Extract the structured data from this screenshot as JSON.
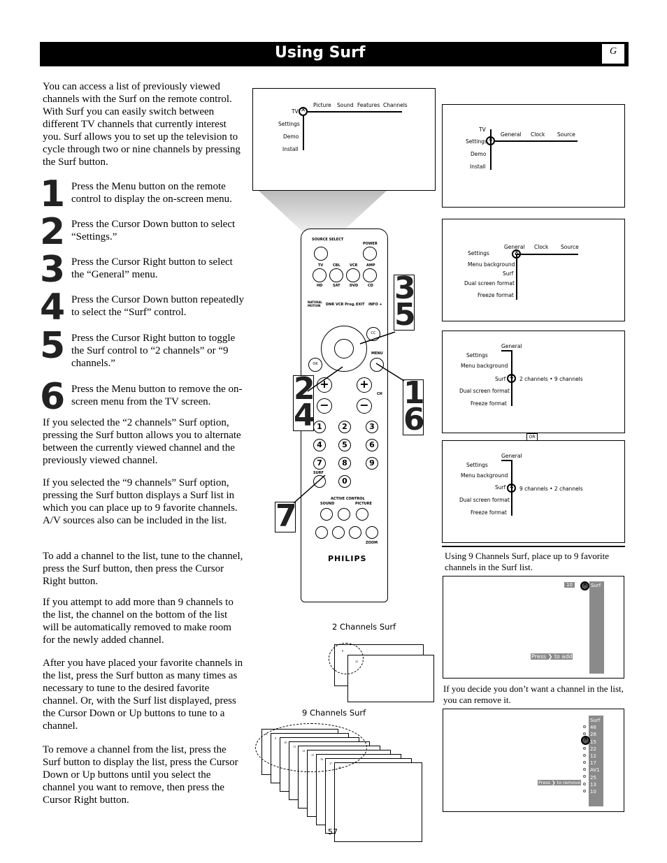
{
  "header": {
    "title": "Using Surf",
    "section_letter": "G"
  },
  "intro": "You can access a list of previously viewed channels with the Surf on the remote control. With Surf you can easily switch between different TV channels that currently interest you. Surf allows you to set up the television to cycle through two or nine channels by pressing the Surf button.",
  "steps": [
    {
      "num": "1",
      "text": "Press the Menu button on the remote control to display the on-screen menu."
    },
    {
      "num": "2",
      "text": "Press the Cursor Down button to select “Settings.”"
    },
    {
      "num": "3",
      "text": "Press the Cursor Right button to select the “General” menu."
    },
    {
      "num": "4",
      "text": "Press the Cursor Down button repeatedly to select the “Surf” control."
    },
    {
      "num": "5",
      "text": "Press the Cursor Right button to toggle the Surf control to “2 channels” or “9 channels.”"
    },
    {
      "num": "6",
      "text": "Press the Menu button to remove the on-screen menu from the TV screen."
    }
  ],
  "paragraphs": [
    "If you selected the “2 channels” Surf option, pressing the Surf button allows you to alternate between the currently viewed channel and the previously viewed channel.",
    "If you selected the “9 channels” Surf option, pressing the Surf button displays a Surf list in which you can place up to 9 favorite channels. A/V sources also can be included in the list.",
    "To add a channel to the list, tune to the channel, press the Surf button, then press the Cursor Right button.",
    "If you attempt to add more than 9 channels to the list, the channel on the bottom of the list will be automatically removed to make room for the newly added channel.",
    "After you have placed your favorite channels in the list, press the Surf button as many times as necessary to tune to the desired favorite channel. Or, with the Surf list displayed, press the Cursor Down or Up buttons to tune to a channel.",
    "To remove a channel from the list, press the Surf button to display the list, press the Cursor Down or Up buttons until you select the channel you want to remove, then press the Cursor Right button."
  ],
  "menu1": {
    "items": [
      "TV",
      "Settings",
      "Demo",
      "Install"
    ],
    "top": [
      "Picture",
      "Sound",
      "Features",
      "Channels"
    ]
  },
  "menu2": {
    "items": [
      "TV",
      "Settings",
      "Demo",
      "Install"
    ],
    "top": [
      "General",
      "Clock",
      "Source"
    ]
  },
  "menu3": {
    "items": [
      "Settings",
      "Menu  background",
      "Surf",
      "Dual  screen  format",
      "Freeze  format"
    ],
    "top": [
      "General",
      "Clock",
      "Source"
    ]
  },
  "menu4": {
    "top": "General",
    "items": [
      "Settings",
      "Menu  background",
      "Surf",
      "Dual  screen  format",
      "Freeze  format"
    ],
    "value": "2  channels  •  9  channels"
  },
  "or_label": "OR",
  "menu5": {
    "top": "General",
    "items": [
      "Settings",
      "Menu  background",
      "Surf",
      "Dual  screen  format",
      "Freeze  format"
    ],
    "value": "9  channels  •  2  channels"
  },
  "remote": {
    "brand": "PHILIPS",
    "labels": {
      "source_select": "SOURCE SELECT",
      "power": "POWER",
      "tv": "TV",
      "cbl": "CBL",
      "vcr": "VCR",
      "amp": "AMP",
      "hd": "HD",
      "sat": "SAT",
      "dvd": "DVD",
      "cd": "CD",
      "natural_motion": "NATURAL MOTION",
      "dnr": "DNR",
      "vcr_prog": "VCR Prog.",
      "exit": "EXIT",
      "info": "INFO +",
      "ok": "OK",
      "menu": "MENU",
      "ch": "CH",
      "surf": "SURF",
      "active_control": "ACTIVE CONTROL",
      "sound": "SOUND",
      "picture": "PICTURE",
      "zoom": "ZOOM",
      "cc": "CC"
    },
    "keys": [
      "1",
      "2",
      "3",
      "4",
      "5",
      "6",
      "7",
      "8",
      "9",
      "0"
    ]
  },
  "callouts": {
    "c35": [
      "3",
      "5"
    ],
    "c24": [
      "2",
      "4"
    ],
    "c16": [
      "1",
      "6"
    ],
    "c7": "7"
  },
  "two_channels": {
    "label": "2 Channels Surf",
    "ch": [
      "8",
      "22"
    ]
  },
  "nine_channels": {
    "label": "9 Channels Surf",
    "ch": [
      "8",
      "9",
      "10",
      "13",
      "14",
      "15",
      "16",
      "17",
      "46"
    ]
  },
  "surf_add": {
    "caption": "Using 9 Channels Surf, place up to 9 favorite channels in the Surf list.",
    "channel": "10",
    "list_title": "Surf",
    "prompt": "Press ❯ to add"
  },
  "surf_remove": {
    "caption": "If you decide you don’t want a channel in the list, you can remove it.",
    "list_title": "Surf",
    "channels": [
      "46",
      "28",
      "15",
      "22",
      "12",
      "17",
      "AV1",
      "25",
      "13",
      "10"
    ],
    "prompt": "Press ❯ to remove"
  },
  "page_number": "57"
}
